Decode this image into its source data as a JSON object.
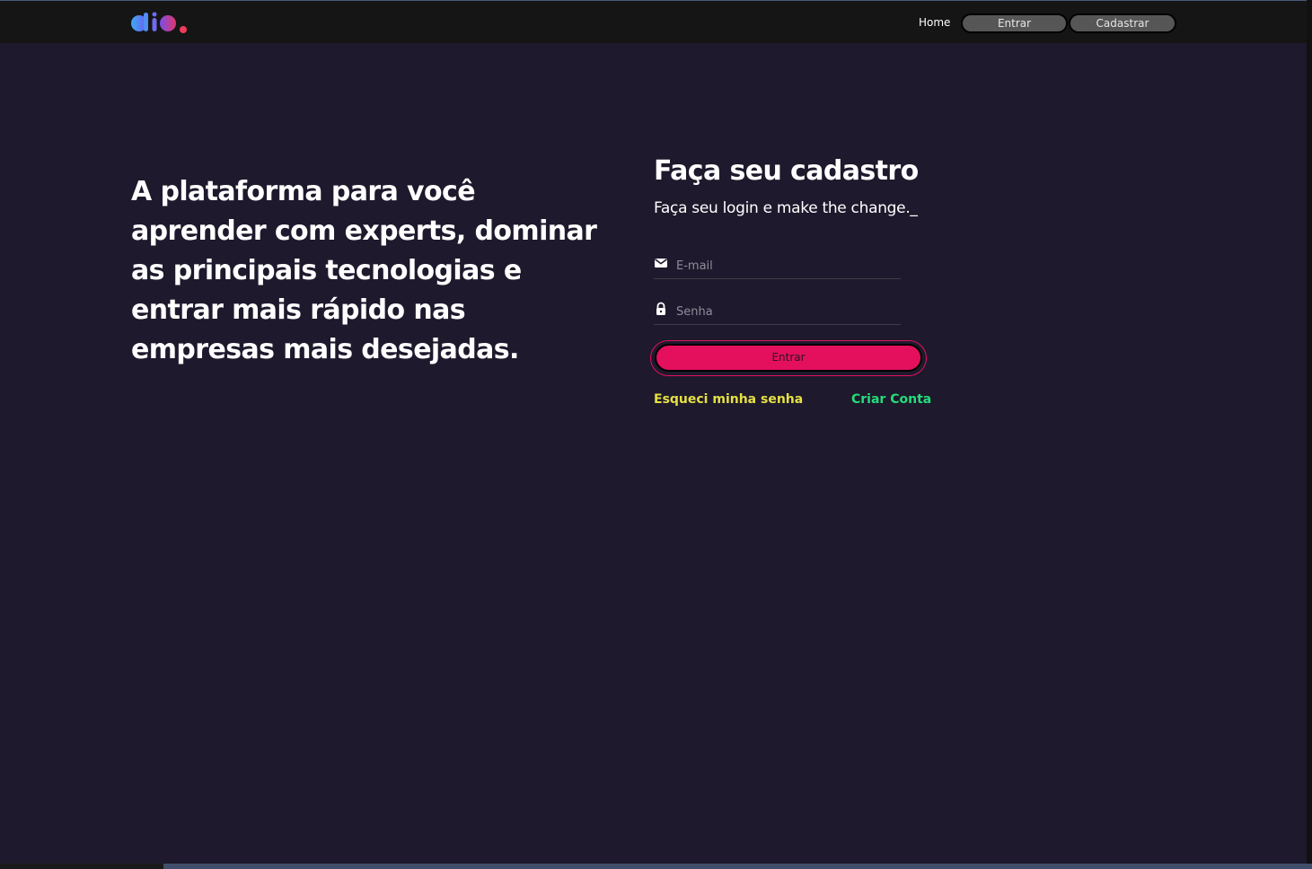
{
  "header": {
    "logo": "dio-logo",
    "nav": {
      "home_label": "Home",
      "login_label": "Entrar",
      "signup_label": "Cadastrar"
    }
  },
  "hero": {
    "text": "A plataforma para você aprender com experts, dominar as principais tecnologias e entrar mais rápido nas empresas mais desejadas."
  },
  "form": {
    "title": "Faça seu cadastro",
    "subtitle": "Faça seu login e make the change._",
    "email": {
      "icon": "mail-icon",
      "placeholder": "E-mail",
      "value": ""
    },
    "password": {
      "icon": "lock-icon",
      "placeholder": "Senha",
      "value": ""
    },
    "submit_label": "Entrar",
    "forgot_label": "Esqueci minha senha",
    "create_label": "Criar Conta"
  },
  "colors": {
    "background": "#1e192c",
    "header": "#151515",
    "primary": "#e4105d",
    "forgot_link": "#e5e044",
    "create_link": "#23dd7a"
  }
}
